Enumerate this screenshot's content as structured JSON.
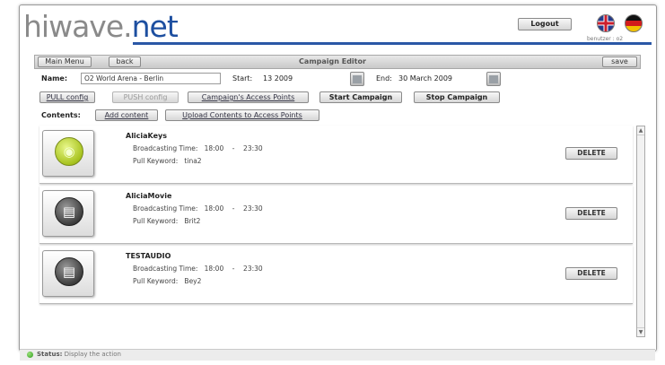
{
  "header": {
    "logo_part1": "hiwave.",
    "logo_part2": "net",
    "logout_label": "Logout",
    "user_text": "benutzer : o2"
  },
  "toolbar": {
    "main_menu_label": "Main Menu",
    "back_label": "back",
    "page_title": "Campaign Editor",
    "save_label": "save"
  },
  "form": {
    "name_label": "Name:",
    "name_value": "O2 World Arena - Berlin",
    "start_label": "Start:",
    "start_value": "13 2009",
    "end_label": "End:",
    "end_value": "30 March 2009"
  },
  "actions": {
    "pull_config": "PULL config",
    "push_config": "PUSH config",
    "access_points": "Campaign's Access Points",
    "start_campaign": "Start Campaign",
    "stop_campaign": "Stop Campaign"
  },
  "contents": {
    "label": "Contents:",
    "add_content": "Add content",
    "upload_content": "Upload Contents to Access Points"
  },
  "items": [
    {
      "title": "AliciaKeys",
      "broadcast_label": "Broadcasting Time:",
      "time_from": "18:00",
      "time_sep": "-",
      "time_to": "23:30",
      "keyword_label": "Pull Keyword:",
      "keyword": "tina2",
      "delete_label": "DELETE",
      "icon": "camera-icon"
    },
    {
      "title": "AliciaMovie",
      "broadcast_label": "Broadcasting Time:",
      "time_from": "18:00",
      "time_sep": "-",
      "time_to": "23:30",
      "keyword_label": "Pull Keyword:",
      "keyword": "Brit2",
      "delete_label": "DELETE",
      "icon": "film-icon"
    },
    {
      "title": "TESTAUDIO",
      "broadcast_label": "Broadcasting Time:",
      "time_from": "18:00",
      "time_sep": "-",
      "time_to": "23:30",
      "keyword_label": "Pull Keyword:",
      "keyword": "Bey2",
      "delete_label": "DELETE",
      "icon": "film-icon"
    }
  ],
  "status": {
    "label": "Status:",
    "text": "Display the action"
  },
  "colors": {
    "brand_blue": "#1d4fa0",
    "brand_gray": "#8a8a8a"
  }
}
